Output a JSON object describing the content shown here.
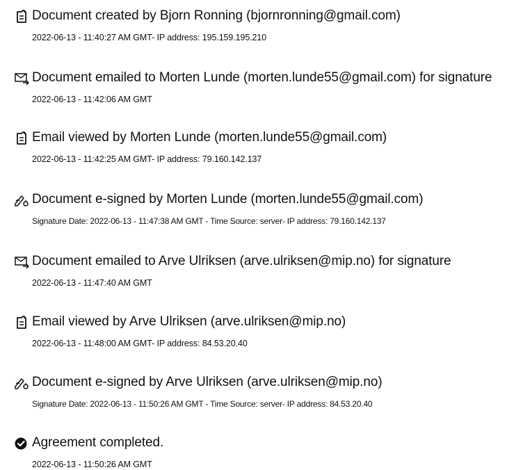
{
  "entries": [
    {
      "icon": "document-icon",
      "title": "Document created by Bjorn Ronning (bjornronning@gmail.com)",
      "detail": "2022-06-13 - 11:40:27 AM GMT- IP address: 195.159.195.210"
    },
    {
      "icon": "email-sent-icon",
      "title": "Document emailed to Morten Lunde (morten.lunde55@gmail.com) for signature",
      "detail": "2022-06-13 - 11:42:06 AM GMT"
    },
    {
      "icon": "document-icon",
      "title": "Email viewed by Morten Lunde (morten.lunde55@gmail.com)",
      "detail": "2022-06-13 - 11:42:25 AM GMT- IP address: 79.160.142.137"
    },
    {
      "icon": "signature-pen-icon",
      "title": "Document e-signed by Morten Lunde (morten.lunde55@gmail.com)",
      "detail": "Signature Date: 2022-06-13 - 11:47:38 AM GMT - Time Source: server- IP address: 79.160.142.137"
    },
    {
      "icon": "email-sent-icon",
      "title": "Document emailed to Arve Ulriksen (arve.ulriksen@mip.no) for signature",
      "detail": "2022-06-13 - 11:47:40 AM GMT"
    },
    {
      "icon": "document-icon",
      "title": "Email viewed by Arve Ulriksen (arve.ulriksen@mip.no)",
      "detail": "2022-06-13 - 11:48:00 AM GMT- IP address: 84.53.20.40"
    },
    {
      "icon": "signature-pen-icon",
      "title": "Document e-signed by Arve Ulriksen (arve.ulriksen@mip.no)",
      "detail": "Signature Date: 2022-06-13 - 11:50:26 AM GMT - Time Source: server- IP address: 84.53.20.40"
    },
    {
      "icon": "checkmark-circle-icon",
      "title": "Agreement completed.",
      "detail": "2022-06-13 - 11:50:26 AM GMT"
    }
  ]
}
